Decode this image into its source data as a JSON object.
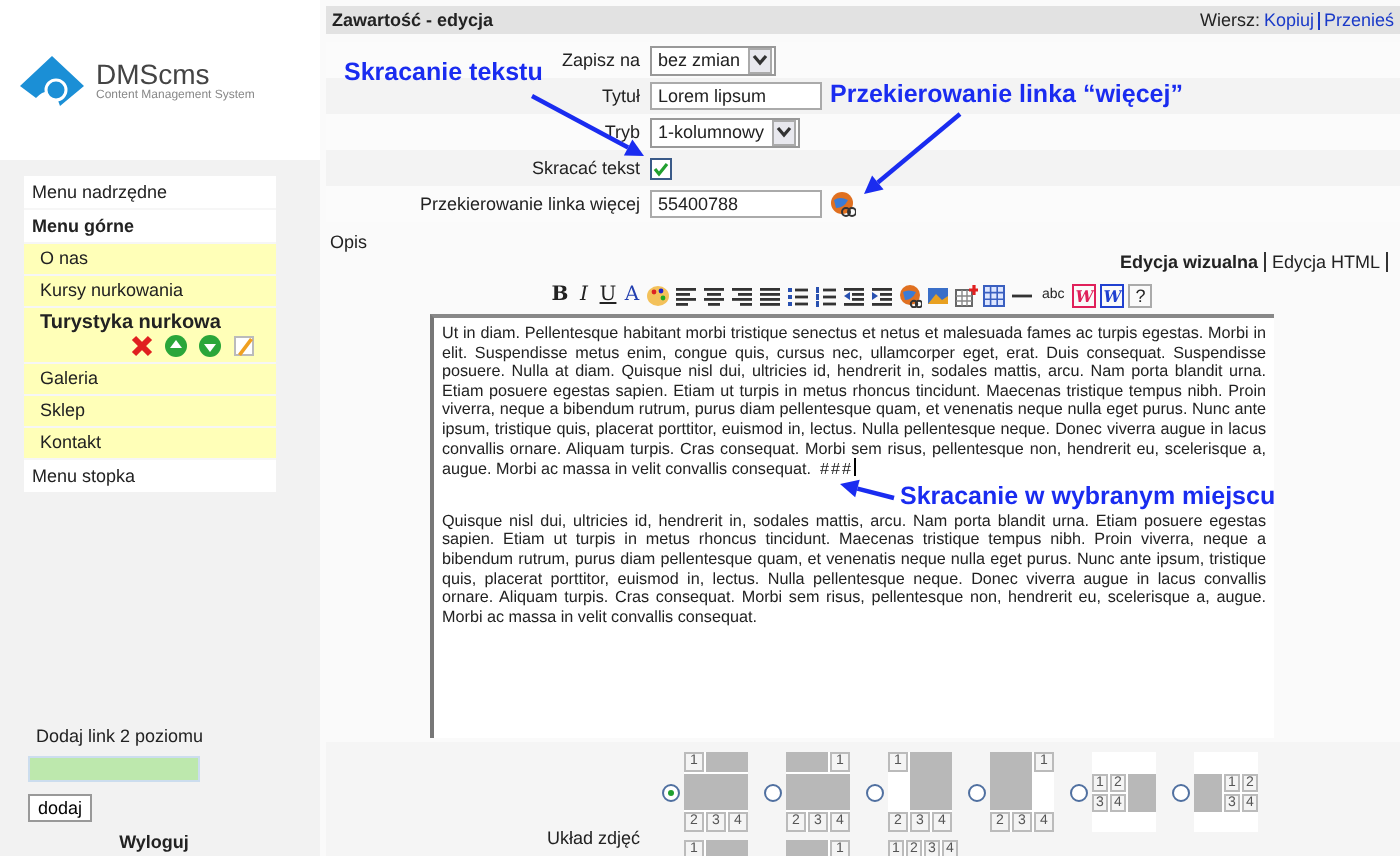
{
  "logo": {
    "name": "DMScms",
    "tagline": "Content Management System"
  },
  "menus": [
    {
      "label": "Menu nadrzędne",
      "expanded": false
    },
    {
      "label": "Menu górne",
      "expanded": true,
      "children": [
        {
          "label": "O nas",
          "selected": false
        },
        {
          "label": "Kursy nurkowania",
          "selected": false
        },
        {
          "label": "Turystyka nurkowa",
          "selected": true,
          "actions": [
            {
              "kind": "delete"
            },
            {
              "kind": "move-up"
            },
            {
              "kind": "move-down"
            },
            {
              "kind": "edit"
            }
          ]
        },
        {
          "label": "Galeria",
          "selected": false
        },
        {
          "label": "Sklep",
          "selected": false
        },
        {
          "label": "Kontakt",
          "selected": false
        }
      ]
    },
    {
      "label": "Menu stopka",
      "expanded": false
    }
  ],
  "add_link": {
    "label": "Dodaj link 2 poziomu",
    "button": "dodaj"
  },
  "logout": "Wyloguj",
  "header": {
    "title": "Zawartość - edycja",
    "row_label": "Wiersz:",
    "links": [
      "Kopiuj",
      "Przenieś"
    ]
  },
  "form": [
    {
      "kind": "select",
      "label": "Zapisz na",
      "value": "bez zmian"
    },
    {
      "kind": "text",
      "label": "Tytuł",
      "value": "Lorem lipsum"
    },
    {
      "kind": "select",
      "label": "Tryb",
      "value": "1-kolumnowy"
    },
    {
      "kind": "checkbox",
      "label": "Skracać tekst",
      "checked": true
    },
    {
      "kind": "link",
      "label": "Przekierowanie linka więcej",
      "value": "55400788"
    }
  ],
  "description_label": "Opis",
  "editor_tabs": [
    {
      "label": "Edycja wizualna",
      "selected": true
    },
    {
      "label": "Edycja HTML",
      "selected": false
    }
  ],
  "toolbar": [
    {
      "kind": "bold",
      "label": "B"
    },
    {
      "kind": "italic",
      "label": "I"
    },
    {
      "kind": "underline",
      "label": "U"
    },
    {
      "kind": "font-color",
      "label": "A"
    },
    {
      "kind": "palette"
    },
    {
      "kind": "align-left"
    },
    {
      "kind": "align-center"
    },
    {
      "kind": "align-right"
    },
    {
      "kind": "justify"
    },
    {
      "kind": "bullet-list"
    },
    {
      "kind": "numbered-list"
    },
    {
      "kind": "outdent"
    },
    {
      "kind": "indent"
    },
    {
      "kind": "link"
    },
    {
      "kind": "image"
    },
    {
      "kind": "insert-table"
    },
    {
      "kind": "table"
    },
    {
      "kind": "rule"
    },
    {
      "kind": "insert-text",
      "label": "abc"
    },
    {
      "kind": "word-red",
      "label": "W"
    },
    {
      "kind": "word-blue",
      "label": "W"
    },
    {
      "kind": "help",
      "label": "?"
    }
  ],
  "editor": {
    "paragraphs": [
      "Ut in diam. Pellentesque habitant morbi tristique senectus et netus et malesuada fames ac turpis egestas. Morbi in elit. Suspendisse metus enim, congue quis, cursus nec, ullamcorper eget, erat. Duis consequat. Suspendisse posuere. Nulla at diam. Quisque nisl dui, ultricies id, hendrerit in, sodales mattis, arcu. Nam porta blandit urna. Etiam posuere egestas sapien. Etiam ut turpis in metus rhoncus tincidunt. Maecenas tristique tempus nibh. Proin viverra, neque a bibendum rutrum, purus diam pellentesque quam, et venenatis neque nulla eget purus. Nunc ante ipsum, tristique quis, placerat porttitor, euismod in, lectus. Nulla pellentesque neque. Donec viverra augue in lacus convallis ornare. Aliquam turpis. Cras consequat. Morbi sem risus, pellentesque non, hendrerit eu, scelerisque a, augue. Morbi ac massa in velit convallis consequat.",
      "Quisque nisl dui, ultricies id, hendrerit in, sodales mattis, arcu. Nam porta blandit urna. Etiam posuere egestas sapien. Etiam ut turpis in metus rhoncus tincidunt. Maecenas tristique tempus nibh. Proin viverra, neque a bibendum rutrum, purus diam pellentesque quam, et venenatis neque nulla eget purus. Nunc ante ipsum, tristique quis, placerat porttitor, euismod in, lectus. Nulla pellentesque neque. Donec viverra augue in lacus convallis ornare. Aliquam turpis. Cras consequat. Morbi sem risus, pellentesque non, hendrerit eu, scelerisque a, augue. Morbi ac massa in velit convallis consequat."
    ],
    "cut_marker": "###"
  },
  "photo_layout": {
    "label": "Układ zdjęć",
    "options": [
      {
        "kind": "a",
        "selected": true,
        "numbers": [
          "1",
          "2",
          "3",
          "4"
        ]
      },
      {
        "kind": "b",
        "selected": false,
        "numbers": [
          "1",
          "2",
          "3",
          "4"
        ]
      },
      {
        "kind": "c",
        "selected": false,
        "numbers": [
          "1",
          "2",
          "3",
          "4"
        ]
      },
      {
        "kind": "d",
        "selected": false,
        "numbers": [
          "1",
          "2",
          "3",
          "4"
        ]
      },
      {
        "kind": "e",
        "selected": false,
        "numbers": [
          "1",
          "2",
          "3",
          "4"
        ]
      },
      {
        "kind": "f",
        "selected": false,
        "numbers": [
          "1",
          "2",
          "3",
          "4"
        ]
      }
    ],
    "more_options": [
      {
        "kind": "g",
        "numbers": [
          "1"
        ]
      },
      {
        "kind": "h",
        "numbers": [
          "1"
        ]
      },
      {
        "kind": "i",
        "numbers": [
          "1",
          "2",
          "3",
          "4"
        ]
      }
    ]
  },
  "annotations": [
    "Skracanie tekstu",
    "Przekierowanie linka “więcej”",
    "Skracanie w wybranym miejscu"
  ]
}
